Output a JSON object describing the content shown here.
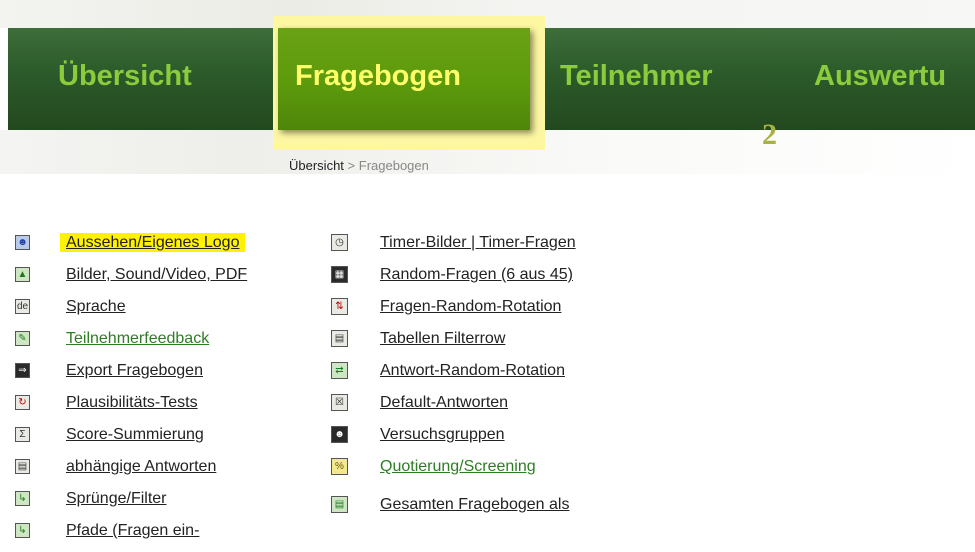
{
  "nav": {
    "tabs": [
      {
        "label": "Übersicht"
      },
      {
        "label": "Fragebogen"
      },
      {
        "label": "Teilnehmer"
      },
      {
        "label": "Auswertu"
      }
    ],
    "active_index": 1,
    "marker": "2"
  },
  "breadcrumb": {
    "home": "Übersicht",
    "separator": " > ",
    "current": "Fragebogen"
  },
  "menu_left": [
    {
      "label": "Aussehen/Eigenes Logo",
      "icon": "person-icon",
      "highlighted": true
    },
    {
      "label": "Bilder, Sound/Video, PDF",
      "icon": "image-icon"
    },
    {
      "label": "Sprache",
      "icon": "language-de-icon",
      "icon_text": "de"
    },
    {
      "label": "Teilnehmerfeedback",
      "icon": "feedback-icon",
      "visited": true
    },
    {
      "label": "Export Fragebogen",
      "icon": "export-icon"
    },
    {
      "label": "Plausibilitäts-Tests",
      "icon": "plausibility-icon"
    },
    {
      "label": "Score-Summierung",
      "icon": "sigma-icon",
      "icon_text": "Σ"
    },
    {
      "label": "abhängige Antworten",
      "icon": "dependent-answers-icon"
    },
    {
      "label": "Sprünge/Filter",
      "icon": "jump-filter-icon"
    },
    {
      "label": "Pfade (Fragen ein-",
      "icon": "path-icon"
    }
  ],
  "menu_right": [
    {
      "label": "Timer-Bilder",
      "label2": "Timer-Fragen",
      "divider": " | ",
      "icon": "timer-icon",
      "visited": true
    },
    {
      "label": "Random-Fragen (6 aus 45)",
      "icon": "film-icon"
    },
    {
      "label": "Fragen-Random-Rotation",
      "icon": "rotation-icon"
    },
    {
      "label": "Tabellen Filterrow",
      "icon": "table-filter-icon"
    },
    {
      "label": "Antwort-Random-Rotation",
      "icon": "answer-rotation-icon"
    },
    {
      "label": "Default-Antworten",
      "icon": "default-answer-icon"
    },
    {
      "label": "Versuchsgruppen",
      "icon": "groups-icon"
    },
    {
      "label": "Quotierung/Screening",
      "icon": "percent-icon",
      "icon_text": "%",
      "visited": true
    },
    {
      "label": "Gesamten Fragebogen als",
      "icon": "duplicate-icon"
    }
  ],
  "colors": {
    "nav_bg": "#2c5a2a",
    "nav_text": "#8ccc3c",
    "active_tab_bg": "#5c9a0c",
    "active_tab_text": "#ffff6a",
    "highlight": "#fff200",
    "visited_link": "#2e7d24"
  }
}
